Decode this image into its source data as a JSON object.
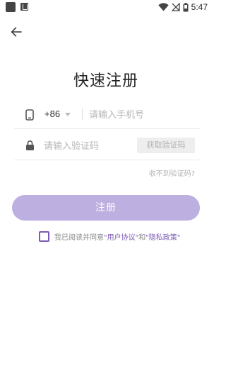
{
  "status_bar": {
    "time": "5:47",
    "icons": [
      "app-notification-icon",
      "store-notification-icon",
      "wifi-icon",
      "no-signal-icon",
      "battery-icon"
    ]
  },
  "header": {
    "back_icon": "arrow-left-icon",
    "title": "快速注册"
  },
  "form": {
    "phone": {
      "icon": "phone-icon",
      "country_code": "+86",
      "placeholder": "请输入手机号",
      "value": ""
    },
    "code": {
      "icon": "lock-icon",
      "placeholder": "请输入验证码",
      "value": "",
      "get_code_label": "获取验证码"
    },
    "no_code_link": "收不到验证码?",
    "register_label": "注册"
  },
  "agreement": {
    "checked": false,
    "prefix": "我已阅读并同意",
    "user_agreement": "\"用户协议\"",
    "and": "和",
    "privacy_policy": "\"隐私政策\""
  },
  "colors": {
    "accent": "#7c5bb5",
    "button_disabled": "#bdafe0",
    "code_button_bg": "#eeeeee",
    "placeholder": "#b5b5b5"
  }
}
